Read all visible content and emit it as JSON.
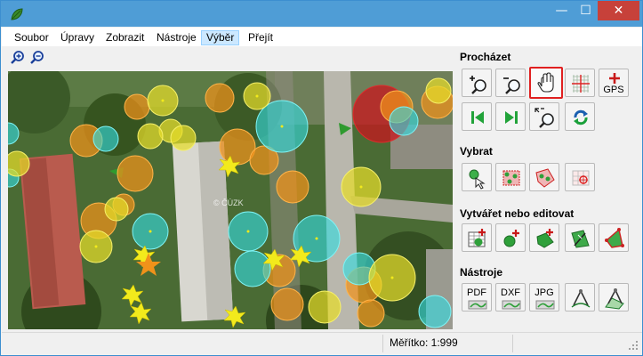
{
  "window": {
    "app_icon": "leaf-icon",
    "controls": {
      "minimize": "—",
      "maximize": "☐",
      "close": "✕"
    }
  },
  "menu": {
    "items": [
      "Soubor",
      "Úpravy",
      "Zobrazit",
      "Nástroje",
      "Výběr",
      "Přejít"
    ],
    "active": "Výběr"
  },
  "zoom": {
    "zoom_in_icon": "zoom-in-icon",
    "zoom_out_icon": "zoom-out-icon"
  },
  "map": {
    "watermark": "© ČÚZK",
    "colors": {
      "yellow": "#e6dc2a",
      "orange": "#f0921a",
      "cyan": "#33dbe0",
      "red": "#c8161e",
      "star": "#f2ea1c"
    }
  },
  "panel": {
    "sections": {
      "browse": {
        "title": "Procházet"
      },
      "select": {
        "title": "Vybrat"
      },
      "create_edit": {
        "title": "Vytvářet nebo editovat"
      },
      "tools": {
        "title": "Nástroje"
      }
    },
    "labels": {
      "gps": "GPS",
      "pdf": "PDF",
      "dxf": "DXF",
      "jpg": "JPG"
    },
    "selected_tool": "pan-tool",
    "selected_color": "#e02020"
  },
  "status": {
    "scale": "Měřítko: 1:999"
  }
}
